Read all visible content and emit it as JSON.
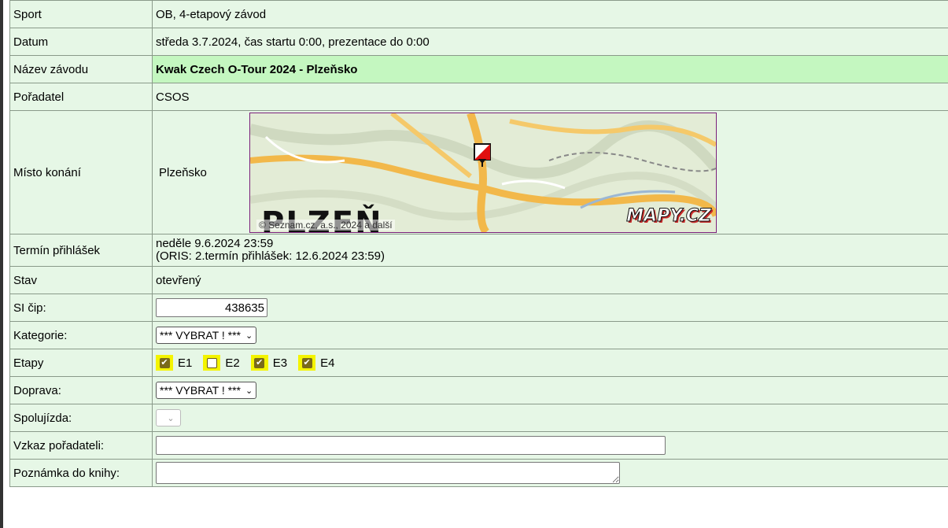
{
  "rows": {
    "sport": {
      "label": "Sport",
      "value": "OB, 4-etapový závod"
    },
    "datum": {
      "label": "Datum",
      "value": "středa 3.7.2024, čas startu 0:00, prezentace do 0:00"
    },
    "nazev": {
      "label": "Název závodu",
      "value": "Kwak Czech O-Tour 2024 - Plzeňsko"
    },
    "poradatel": {
      "label": "Pořadatel",
      "value": "CSOS"
    },
    "misto": {
      "label": "Místo konání",
      "value": "Plzeňsko"
    },
    "termin": {
      "label": "Termín přihlášek",
      "value1": "neděle 9.6.2024 23:59",
      "value2": "(ORIS: 2.termín přihlášek: 12.6.2024 23:59)"
    },
    "stav": {
      "label": "Stav",
      "value": "otevřený"
    },
    "sicip": {
      "label": "SI čip:",
      "value": "438635"
    },
    "kategorie": {
      "label": "Kategorie:",
      "selected": "*** VYBRAT ! ***"
    },
    "etapy": {
      "label": "Etapy",
      "stages": [
        {
          "label": "E1",
          "checked": true
        },
        {
          "label": "E2",
          "checked": false
        },
        {
          "label": "E3",
          "checked": true
        },
        {
          "label": "E4",
          "checked": true
        }
      ]
    },
    "doprava": {
      "label": "Doprava:",
      "selected": "*** VYBRAT ! ***"
    },
    "spolujizda": {
      "label": "Spolujízda:"
    },
    "vzkaz": {
      "label": "Vzkaz pořadateli:",
      "value": ""
    },
    "poznamka": {
      "label": "Poznámka do knihy:",
      "value": ""
    }
  },
  "map": {
    "city": "PLZEŇ",
    "copyright": "© Seznam.cz, a.s., 2024 a další",
    "logo": "MAPY.CZ",
    "marker_icon": "control-flag-icon"
  },
  "colors": {
    "row_bg": "#e6f7e6",
    "highlight_bg": "#c4f7c0",
    "checkbox_highlight": "#f4f400",
    "map_border": "#7a1f7a"
  }
}
